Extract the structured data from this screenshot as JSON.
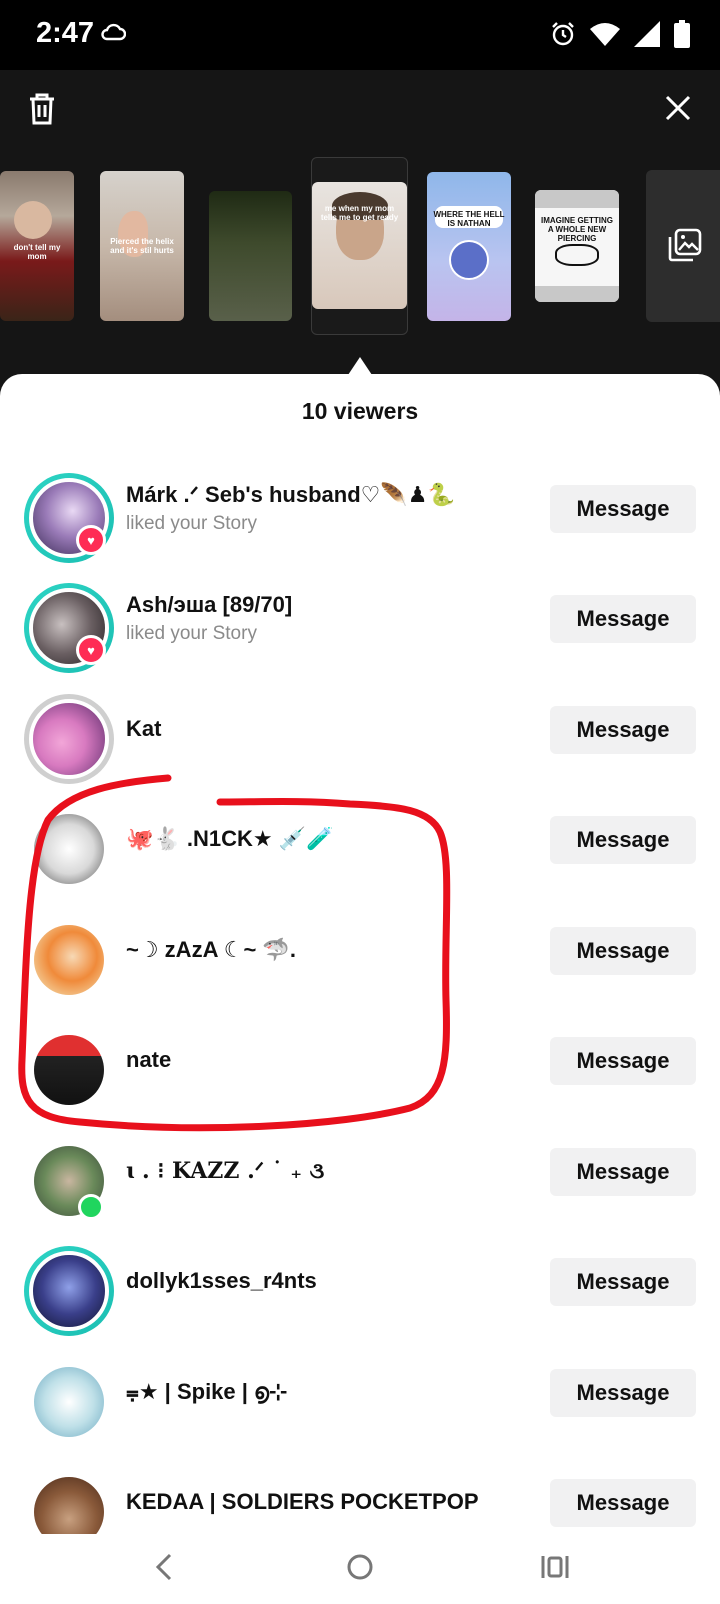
{
  "status_bar": {
    "time": "2:47"
  },
  "sheet": {
    "title": "10 viewers"
  },
  "story_thumbs": [
    {
      "caption": "don't tell my mom"
    },
    {
      "caption": "Pierced the helix and it's stil hurts"
    },
    {
      "caption": ""
    },
    {
      "caption": "me when my mom tells me to get ready"
    },
    {
      "caption": "WHERE THE HELL IS NATHAN"
    },
    {
      "caption": "IMAGINE GETTING A WHOLE NEW PIERCING"
    }
  ],
  "viewers": [
    {
      "name": "Márk .ᐟ Seb's husband♡🪶♟🐍",
      "sub": "liked your Story",
      "button": "Message"
    },
    {
      "name": "Ash/эша [89/70]",
      "sub": "liked your Story",
      "button": "Message"
    },
    {
      "name": "Kat",
      "sub": "",
      "button": "Message"
    },
    {
      "name": "🐙🐇 .N1CK★ 💉🧪",
      "sub": "",
      "button": "Message"
    },
    {
      "name": "~☽ zAzA ☾~ 🦈.",
      "sub": "",
      "button": "Message"
    },
    {
      "name": "nate",
      "sub": "",
      "button": "Message"
    },
    {
      "name": "ɩ  . ⁝ KAZZ .ᐟ ˙ ₊ ૩",
      "sub": "",
      "button": "Message"
    },
    {
      "name": "dollyk1sses_r4nts",
      "sub": "",
      "button": "Message"
    },
    {
      "name": "⩦★ | Spike | ൭⊹",
      "sub": "",
      "button": "Message"
    },
    {
      "name": "KEDAA | SOLDIERS POCKETPOP",
      "sub": "",
      "button": "Message"
    }
  ],
  "colors": {
    "accent_ring": "#2dd4c4",
    "heart_badge": "#fe2c55",
    "online": "#20d55e",
    "annotation": "#e8101c"
  },
  "icons": [
    "trash-icon",
    "close-icon",
    "add-media-icon",
    "heart-icon",
    "back-icon",
    "home-icon",
    "recents-icon"
  ]
}
